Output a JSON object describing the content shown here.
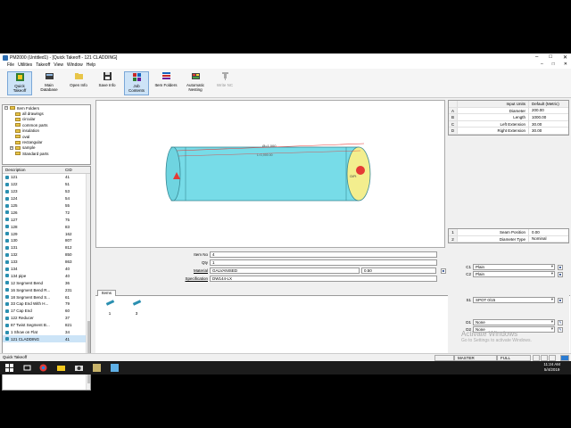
{
  "window": {
    "title": "PM2000 (Untitled1) - [Quick Takeoff - 121 CLADDING]",
    "controls": [
      "–",
      "□",
      "✕"
    ],
    "doc_controls": [
      "–",
      "□",
      "✕"
    ]
  },
  "menu": [
    "File",
    "Utilities",
    "Takeoff",
    "View",
    "Window",
    "Help"
  ],
  "toolbar": [
    {
      "label": "Quick Takeoff",
      "icon": "quick-takeoff-icon"
    },
    {
      "label": "Main Database",
      "icon": "database-icon"
    },
    {
      "label": "Open Info",
      "icon": "open-info-icon"
    },
    {
      "label": "Save Info",
      "icon": "save-icon"
    },
    {
      "label": "Job Contents",
      "icon": "job-contents-icon"
    },
    {
      "label": "Item Folders",
      "icon": "item-folders-icon"
    },
    {
      "label": "Automatic Nesting",
      "icon": "nesting-icon"
    },
    {
      "label": "Write NC",
      "icon": "write-nc-icon"
    }
  ],
  "tree": {
    "root": "Item Folders",
    "folders": [
      "all drawings",
      "circular",
      "common parts",
      "insulation",
      "oval",
      "rectangular",
      "sample",
      "Standard parts"
    ]
  },
  "list": {
    "col_description": "Description",
    "col_cid": "CID",
    "rows": [
      {
        "d": "121",
        "c": "41"
      },
      {
        "d": "122",
        "c": "51"
      },
      {
        "d": "123",
        "c": "53"
      },
      {
        "d": "124",
        "c": "54"
      },
      {
        "d": "125",
        "c": "55"
      },
      {
        "d": "126",
        "c": "72"
      },
      {
        "d": "127",
        "c": "75"
      },
      {
        "d": "128",
        "c": "83"
      },
      {
        "d": "129",
        "c": "162"
      },
      {
        "d": "130",
        "c": "807"
      },
      {
        "d": "131",
        "c": "812"
      },
      {
        "d": "132",
        "c": "850"
      },
      {
        "d": "133",
        "c": "863"
      },
      {
        "d": "134",
        "c": "40"
      },
      {
        "d": "134 pipe",
        "c": "40"
      },
      {
        "d": "12 Segment Bend",
        "c": "36"
      },
      {
        "d": "16 Segment Bend R...",
        "c": "231"
      },
      {
        "d": "18 Segment Bend S...",
        "c": "61"
      },
      {
        "d": "33 Cap End With H...",
        "c": "79"
      },
      {
        "d": "17 Cap End",
        "c": "60"
      },
      {
        "d": "122 Reducer",
        "c": "37"
      },
      {
        "d": "87 Twist Segment B...",
        "c": "821"
      },
      {
        "d": "1 Show on Flat",
        "c": "34"
      },
      {
        "d": "121 CLADDING",
        "c": "41"
      }
    ]
  },
  "view3d": {
    "dim1": "Ø=1,000",
    "dim2": "L=1,000.00",
    "end_label": "Cl/Ft"
  },
  "props": {
    "item_no_label": "Item No",
    "item_no": "4",
    "qty_label": "Qty",
    "qty": "1",
    "material_label": "Material",
    "material": "GALVANISED",
    "gauge": "0.50",
    "spec_label": "Specification",
    "spec": "DW144-LX"
  },
  "tabs": {
    "items": "Items"
  },
  "items": [
    {
      "n": "1"
    },
    {
      "n": "3"
    }
  ],
  "right": {
    "header": {
      "name": "Input Units",
      "value": "Default (Metric)"
    },
    "dims": [
      {
        "k": "A",
        "n": "Diameter",
        "v": "200.00"
      },
      {
        "k": "B",
        "n": "Length",
        "v": "1000.00"
      },
      {
        "k": "C",
        "n": "Left Extension",
        "v": "30.00"
      },
      {
        "k": "D",
        "n": "Right Extension",
        "v": "30.00"
      }
    ],
    "params": [
      {
        "k": "1",
        "n": "Seam Position",
        "v": "0.00"
      },
      {
        "k": "2",
        "n": "Diameter Type",
        "v": "Nominal"
      }
    ],
    "connectors": [
      {
        "k": "C1",
        "v": "Plain"
      },
      {
        "k": "C2",
        "v": "Plain"
      }
    ],
    "seam": {
      "k": "S1",
      "v": "SPOT 0/15"
    },
    "doors": [
      {
        "k": "D1",
        "v": "None"
      },
      {
        "k": "D2",
        "v": "None"
      }
    ]
  },
  "status": {
    "left": "Quick Takeoff",
    "master": "MASTER",
    "full": "FULL"
  },
  "watermark": {
    "line1": "Activate Windows",
    "line2": "Go to Settings to activate Windows."
  },
  "clock": {
    "time": "11:24 AM",
    "date": "5/4/2019"
  }
}
